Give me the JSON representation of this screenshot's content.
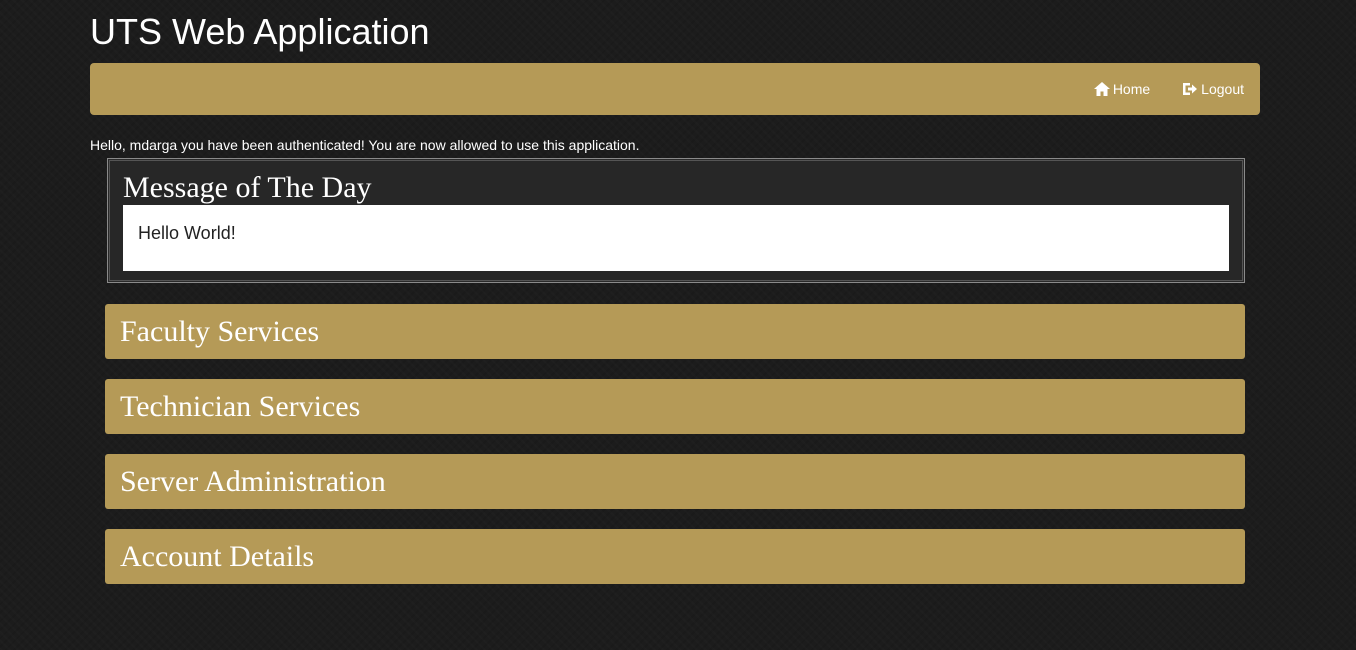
{
  "app": {
    "title": "UTS Web Application"
  },
  "nav": {
    "home_label": "Home",
    "logout_label": "Logout"
  },
  "greeting": "Hello, mdarga you have been authenticated! You are now allowed to use this application.",
  "motd": {
    "title": "Message of The Day",
    "message": "Hello World!"
  },
  "sections": [
    {
      "label": "Faculty Services"
    },
    {
      "label": "Technician Services"
    },
    {
      "label": "Server Administration"
    },
    {
      "label": "Account Details"
    }
  ],
  "colors": {
    "background": "#1c1c1c",
    "accent_gold": "#b59a57",
    "text": "#ffffff"
  }
}
